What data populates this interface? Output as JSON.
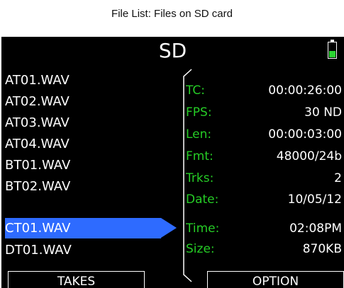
{
  "caption": "File List: Files on SD card",
  "screen": {
    "title": "SD",
    "battery": {
      "level": 0.45,
      "color": "#2bd432"
    },
    "files": [
      {
        "name": "AT01.WAV",
        "selected": false
      },
      {
        "name": "AT02.WAV",
        "selected": false
      },
      {
        "name": "AT03.WAV",
        "selected": false
      },
      {
        "name": "AT04.WAV",
        "selected": false
      },
      {
        "name": "BT01.WAV",
        "selected": false
      },
      {
        "name": "BT02.WAV",
        "selected": false
      },
      {
        "name": "CT01.WAV",
        "selected": true
      },
      {
        "name": "DT01.WAV",
        "selected": false
      }
    ],
    "details": [
      {
        "label": "TC:",
        "value": "00:00:26:00"
      },
      {
        "label": "FPS:",
        "value": "30 ND"
      },
      {
        "label": "Len:",
        "value": "00:00:03:00"
      },
      {
        "label": "Fmt:",
        "value": "48000/24b"
      },
      {
        "label": "Trks:",
        "value": "2"
      },
      {
        "label": "Date:",
        "value": "10/05/12"
      },
      {
        "label": "Time:",
        "value": "02:08PM"
      },
      {
        "label": "Size:",
        "value": "870KB"
      }
    ],
    "softkeys": {
      "left": "TAKES",
      "right": "OPTION"
    },
    "colors": {
      "selection": "#2e6bff",
      "label": "#26cc26",
      "background": "#000000"
    }
  }
}
